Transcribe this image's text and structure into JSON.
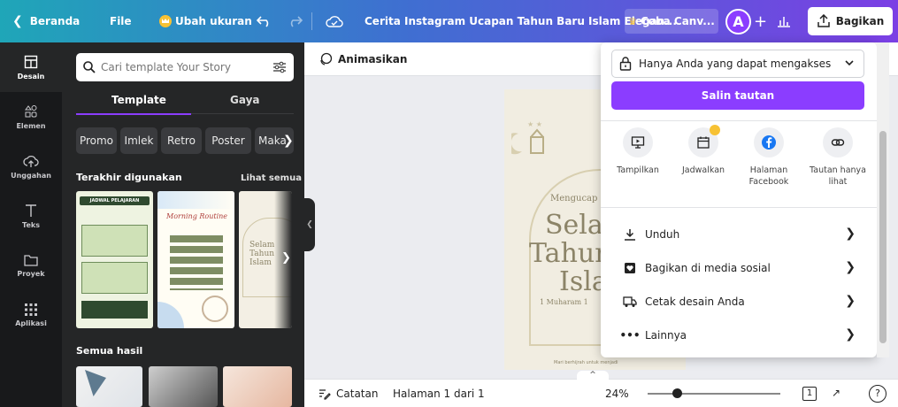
{
  "topbar": {
    "back_label": "Beranda",
    "file_label": "File",
    "resize_label": "Ubah ukuran",
    "doc_title": "Cerita Instagram Ucapan Tahun Baru Islam Elegan...",
    "try_label": "Coba Canv...",
    "avatar_letter": "A",
    "plus": "+",
    "share_label": "Bagikan"
  },
  "rail": {
    "items": [
      {
        "label": "Desain",
        "icon": "design-icon"
      },
      {
        "label": "Elemen",
        "icon": "elements-icon"
      },
      {
        "label": "Unggahan",
        "icon": "upload-icon"
      },
      {
        "label": "Teks",
        "icon": "text-icon"
      },
      {
        "label": "Proyek",
        "icon": "folder-icon"
      },
      {
        "label": "Aplikasi",
        "icon": "apps-icon"
      }
    ]
  },
  "panel": {
    "search_placeholder": "Cari template Your Story",
    "tabs": [
      "Template",
      "Gaya"
    ],
    "chips": [
      "Promo",
      "Imlek",
      "Retro",
      "Poster",
      "Maka"
    ],
    "recent_title": "Terakhir digunakan",
    "see_all": "Lihat semua",
    "recent_thumbs": [
      {
        "title": "JADWAL PELAJARAN"
      },
      {
        "title": "Morning Routine"
      },
      {
        "title": "Selam Tahun Islam"
      }
    ],
    "all_results_title": "Semua hasil"
  },
  "canvas": {
    "animate_label": "Animasikan",
    "design_text": {
      "greeting": "Mengucap",
      "line1": "Selar",
      "line2": "Tahun",
      "line3": "Isla",
      "date": "1 Muharam 1",
      "footer": "Mari berhijrah untuk menjadi"
    },
    "notes_label": "Catatan",
    "page_label": "Halaman 1 dari 1",
    "zoom": "24%",
    "help": "?"
  },
  "share_popup": {
    "access_label": "Hanya Anda yang dapat mengakses",
    "copy_link_label": "Salin tautan",
    "options": [
      {
        "label": "Tampilkan",
        "icon": "present-icon"
      },
      {
        "label": "Jadwalkan",
        "icon": "calendar-icon"
      },
      {
        "label": "Halaman Facebook",
        "icon": "facebook-icon"
      },
      {
        "label": "Tautan hanya lihat",
        "icon": "link-icon"
      }
    ],
    "rows": [
      {
        "label": "Unduh",
        "icon": "download-icon"
      },
      {
        "label": "Bagikan di media sosial",
        "icon": "heart-box-icon"
      },
      {
        "label": "Cetak desain Anda",
        "icon": "truck-icon"
      },
      {
        "label": "Lainnya",
        "icon": "more-icon"
      }
    ]
  },
  "colors": {
    "accent": "#8b3dff",
    "topbar_start": "#1fa6b8",
    "topbar_end": "#7b3fe4",
    "panel_bg": "#252627",
    "rail_bg": "#18191b"
  }
}
